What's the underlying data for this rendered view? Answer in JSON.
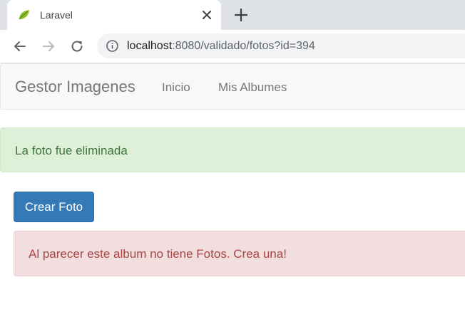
{
  "browser": {
    "tab": {
      "title": "Laravel",
      "favicon": "laravel-leaf-icon"
    },
    "address": {
      "host": "localhost",
      "path": ":8080/validado/fotos?id=394"
    },
    "icons": {
      "back": "back-arrow-icon",
      "forward": "forward-arrow-icon",
      "reload": "reload-icon",
      "info": "info-icon",
      "close": "close-icon",
      "new_tab": "plus-icon"
    }
  },
  "navbar": {
    "brand": "Gestor Imagenes",
    "links": [
      {
        "label": "Inicio"
      },
      {
        "label": "Mis Albumes"
      }
    ]
  },
  "alerts": {
    "success": "La foto fue eliminada",
    "danger": "Al parecer este album no tiene Fotos. Crea una!"
  },
  "actions": {
    "create_photo": "Crear Foto"
  },
  "colors": {
    "primary": "#337ab7",
    "success_bg": "#dff0d8",
    "success_text": "#3c763d",
    "danger_bg": "#f2dede",
    "danger_text": "#a94442",
    "navbar_bg": "#f8f8f8",
    "chrome_bg": "#dee1e6"
  }
}
